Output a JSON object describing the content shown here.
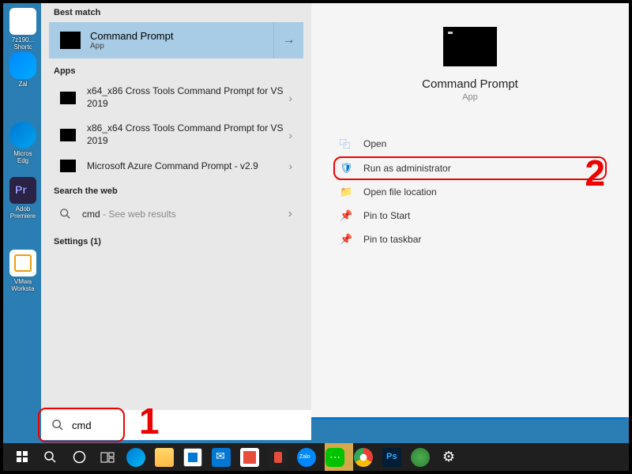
{
  "desktop": {
    "icons": [
      {
        "label": "7z190...\nShortc"
      },
      {
        "label": "Zal"
      },
      {
        "label": "Micros\nEdg"
      },
      {
        "label": "Adob\nPremiere"
      },
      {
        "label": "VMwa\nWorksta"
      }
    ]
  },
  "searchPanel": {
    "bestMatchLabel": "Best match",
    "bestMatch": {
      "title": "Command Prompt",
      "subtitle": "App"
    },
    "appsLabel": "Apps",
    "apps": [
      {
        "title": "x64_x86 Cross Tools Command Prompt for VS 2019"
      },
      {
        "title": "x86_x64 Cross Tools Command Prompt for VS 2019"
      },
      {
        "title": "Microsoft Azure Command Prompt - v2.9"
      }
    ],
    "webLabel": "Search the web",
    "webItem": {
      "term": "cmd",
      "suffix": " - See web results"
    },
    "settingsLabel": "Settings (1)"
  },
  "details": {
    "title": "Command Prompt",
    "subtitle": "App",
    "actions": [
      {
        "label": "Open",
        "icon": "open"
      },
      {
        "label": "Run as administrator",
        "icon": "shield",
        "highlight": true
      },
      {
        "label": "Open file location",
        "icon": "folder"
      },
      {
        "label": "Pin to Start",
        "icon": "pin"
      },
      {
        "label": "Pin to taskbar",
        "icon": "pin"
      }
    ]
  },
  "searchBox": {
    "value": "cmd"
  },
  "annotations": {
    "one": "1",
    "two": "2"
  },
  "taskbar": {
    "items": [
      "start",
      "search",
      "cortana",
      "taskview",
      "edge",
      "folder",
      "store",
      "mail",
      "gift",
      "office",
      "zalo",
      "line",
      "chrome",
      "ps",
      "green",
      "gear"
    ]
  }
}
